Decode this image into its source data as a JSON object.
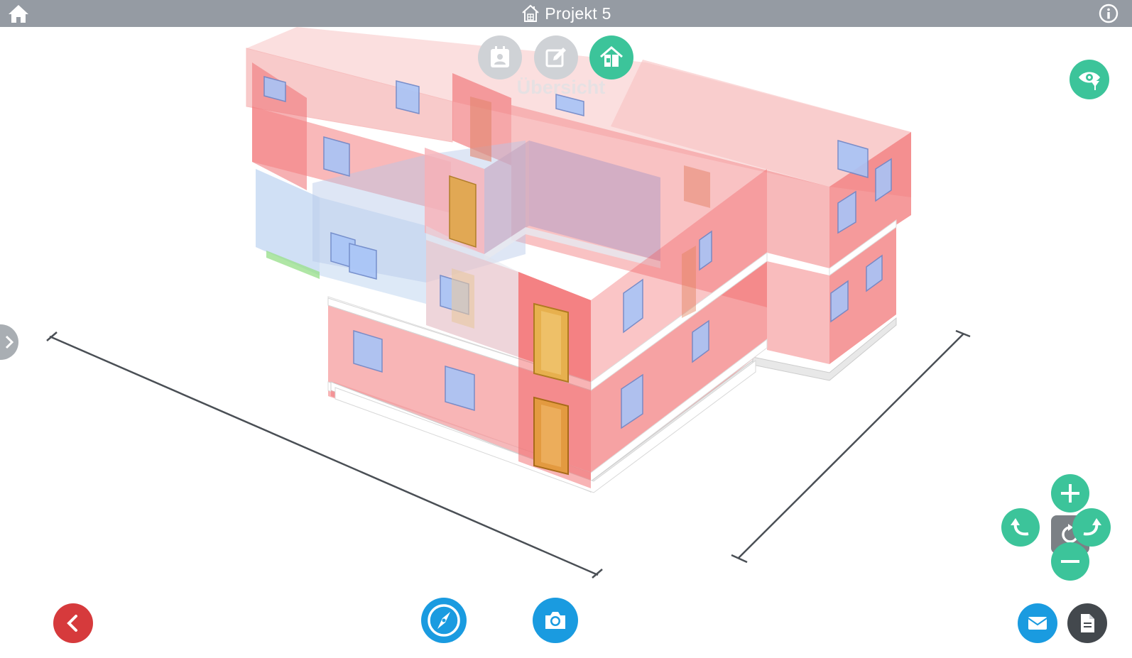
{
  "header": {
    "title": "Projekt 5",
    "home_icon": "home-icon",
    "info_icon": "info-icon"
  },
  "mode_bar": {
    "buttons": [
      {
        "icon": "contact-card-icon",
        "active": false
      },
      {
        "icon": "edit-icon",
        "active": false
      },
      {
        "icon": "house-overview-icon",
        "active": true
      }
    ],
    "active_label": "Übersicht"
  },
  "colors": {
    "header_bg": "#959ba3",
    "accent_green": "#3cc49a",
    "back_red": "#d63a3c",
    "action_blue": "#1a9be0",
    "dark_gray": "#43484d",
    "wall_red": "#f06a6a",
    "glass_blue": "#8fb8f0"
  },
  "controls": {
    "view_filter_icon": "eye-filter-icon",
    "side_panel_icon": "chevron-right-icon",
    "zoom_in_icon": "plus-icon",
    "zoom_out_icon": "minus-icon",
    "rotate_left_icon": "rotate-left-icon",
    "rotate_right_icon": "rotate-right-icon",
    "reset_view_icon": "reset-view-icon"
  },
  "bottom_bar": {
    "back_icon": "chevron-left-icon",
    "compass_icon": "compass-icon",
    "camera_icon": "camera-icon",
    "mail_icon": "mail-icon",
    "document_icon": "document-icon"
  }
}
